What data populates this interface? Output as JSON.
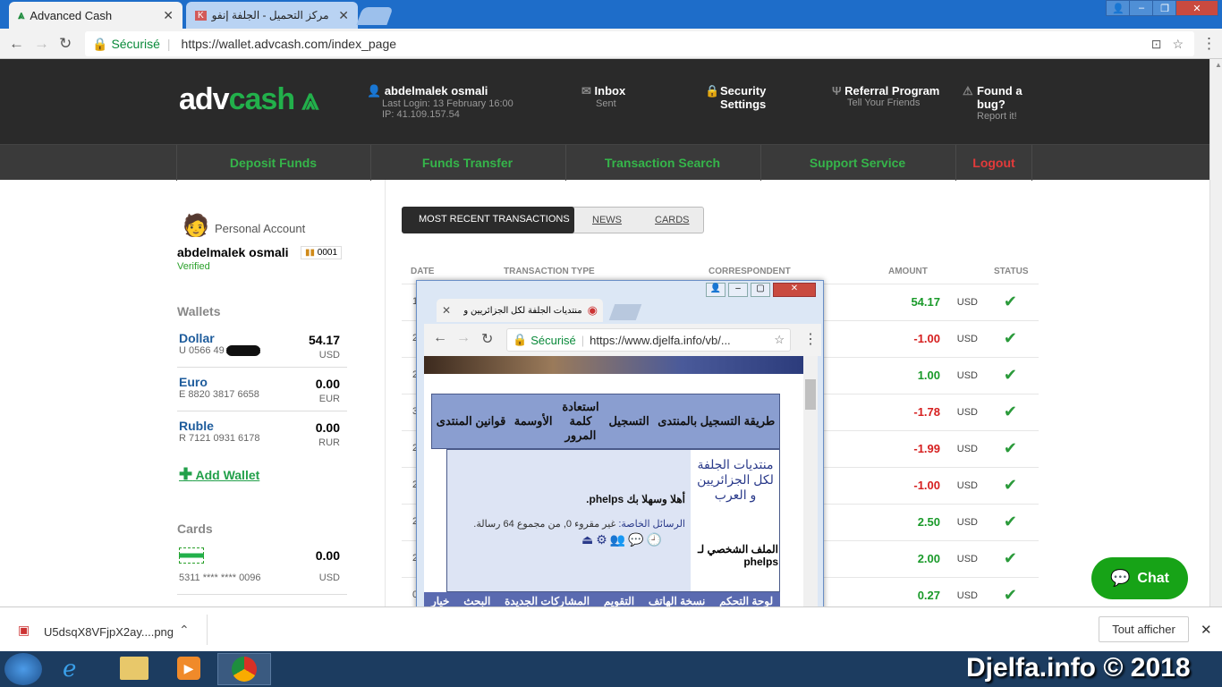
{
  "browser": {
    "tab1_title": "Advanced Cash",
    "tab2_title": "مركز التحميل - الجلفة إنفو",
    "secure_label": "Sécurisé",
    "url": "https://wallet.advcash.com/index_page"
  },
  "header": {
    "logo_a": "adv",
    "logo_b": "cash",
    "user_name": "abdelmalek osmali",
    "last_login": "Last Login: 13 February 16:00",
    "ip": "IP: 41.109.157.54",
    "inbox": "Inbox",
    "inbox_sub": "Sent",
    "security": "Security Settings",
    "referral": "Referral Program",
    "referral_sub": "Tell Your Friends",
    "bug": "Found a bug?",
    "bug_sub": "Report it!"
  },
  "nav": {
    "deposit": "Deposit Funds",
    "transfer": "Funds Transfer",
    "search": "Transaction Search",
    "support": "Support Service",
    "logout": "Logout"
  },
  "account": {
    "type": "Personal Account",
    "name": "abdelmalek osmali",
    "badge": "0001",
    "verified": "Verified",
    "wallets_title": "Wallets",
    "wallets": [
      {
        "name": "Dollar",
        "acc": "U 0566 49",
        "value": "54.17",
        "cur": "USD"
      },
      {
        "name": "Euro",
        "acc": "E 8820 3817 6658",
        "value": "0.00",
        "cur": "EUR"
      },
      {
        "name": "Ruble",
        "acc": "R 7121 0931 6178",
        "value": "0.00",
        "cur": "RUR"
      }
    ],
    "add_wallet": "Add Wallet",
    "cards_title": "Cards",
    "card_number": "5311 **** **** 0096",
    "card_value": "0.00",
    "card_cur": "USD"
  },
  "tabs": {
    "recent": "MOST RECENT TRANSACTIONS",
    "news": "NEWS",
    "cards": "CARDS"
  },
  "table": {
    "headers": {
      "date": "DATE",
      "type": "TRANSACTION TYPE",
      "corr": "CORRESPONDENT",
      "amount": "AMOUNT",
      "status": "STATUS"
    },
    "rows": [
      {
        "d": "1",
        "amount": "54.17",
        "cur": "USD",
        "color": "#1a9a2a"
      },
      {
        "d": "2",
        "amount": "-1.00",
        "cur": "USD",
        "color": "#d62020"
      },
      {
        "d": "2",
        "amount": "1.00",
        "cur": "USD",
        "color": "#1a9a2a"
      },
      {
        "d": "3",
        "amount": "-1.78",
        "cur": "USD",
        "color": "#d62020"
      },
      {
        "d": "2",
        "amount": "-1.99",
        "cur": "USD",
        "color": "#d62020"
      },
      {
        "d": "2",
        "amount": "-1.00",
        "cur": "USD",
        "color": "#d62020"
      },
      {
        "d": "2",
        "amount": "2.50",
        "cur": "USD",
        "color": "#1a9a2a"
      },
      {
        "d": "2",
        "amount": "2.00",
        "cur": "USD",
        "color": "#1a9a2a"
      },
      {
        "d": "0",
        "amount": "0.27",
        "cur": "USD",
        "color": "#1a9a2a"
      }
    ]
  },
  "chat": "Chat",
  "popup": {
    "tab_title": "منتديات الجلفة لكل الجزائريين و",
    "secure": "Sécurisé",
    "url": "https://www.djelfa.info/vb/...",
    "menu": [
      "طريقة التسجيل بالمنتدى",
      "التسجيل",
      "استعادة كلمة المرور",
      "الأوسمة",
      "قوانين المنتدى"
    ],
    "forum_title": "منتديات الجلفة لكل الجزائريين و العرب",
    "profile_label": "الملف الشخصي لـ",
    "profile_user": "phelps",
    "welcome": "أهلا وسهلا بك phelps.",
    "messages_label": "الرسائل الخاصة:",
    "messages_text": "غير مقروء 0, من مجموع 64 رسالة.",
    "bottom_menu": [
      "لوحة التحكم",
      "نسخة الهاتف",
      "التقويم",
      "المشاركات الجديدة",
      "البحث",
      "خيار"
    ]
  },
  "download": {
    "file": "U5dsqX8VFjpX2ay....png",
    "show_all": "Tout afficher"
  },
  "watermark": "Djelfa.info © 2018"
}
